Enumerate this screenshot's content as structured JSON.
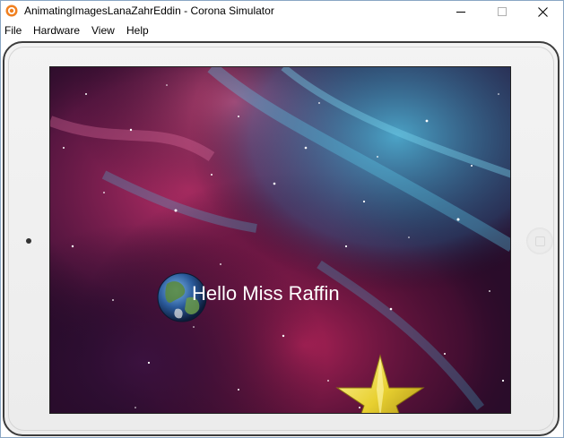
{
  "window": {
    "title": "AnimatingImagesLanaZahrEddin - Corona Simulator"
  },
  "menu": {
    "items": [
      "File",
      "Hardware",
      "View",
      "Help"
    ]
  },
  "screen": {
    "greeting": "Hello Miss Raffin",
    "background": "nebula-space-image"
  },
  "icons": {
    "app": "corona-logo-icon",
    "minimize": "minimize-icon",
    "maximize": "maximize-icon",
    "close": "close-icon",
    "planet": "earth-icon",
    "star": "gold-star-icon"
  },
  "colors": {
    "greeting_text": "#ffffff",
    "star": "#e8d84a",
    "device_frame": "#3c3c3c"
  }
}
